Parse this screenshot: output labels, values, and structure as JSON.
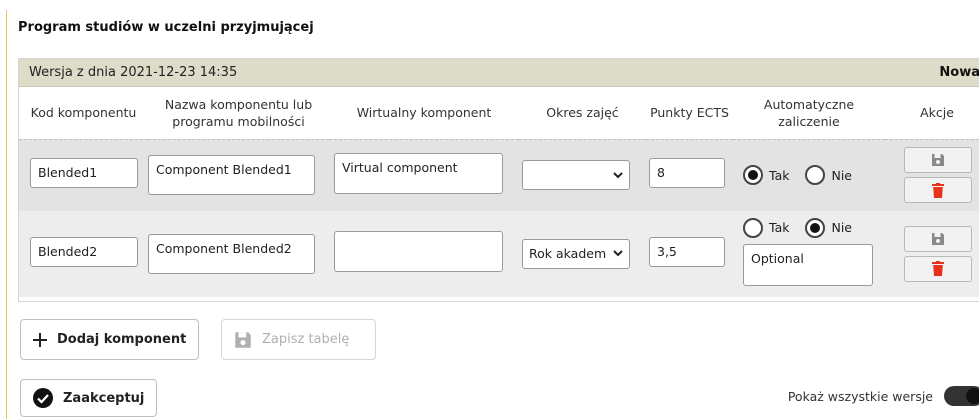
{
  "section": {
    "title": "Program studiów w uczelni przyjmującej"
  },
  "version": {
    "label": "Wersja z dnia 2021-12-23 14:35",
    "new_label": "Nowa"
  },
  "table": {
    "headers": {
      "code": "Kod komponentu",
      "name": "Nazwa komponentu lub programu mobilności",
      "virtual": "Wirtualny komponent",
      "period": "Okres zajęć",
      "ects": "Punkty ECTS",
      "auto": "Automatyczne zaliczenie",
      "actions": "Akcje"
    },
    "rows": [
      {
        "code": "Blended1",
        "name": "Component Blended1",
        "virtual": "Virtual component",
        "period": "",
        "ects": "8",
        "auto_yes": "Tak",
        "auto_no": "Nie",
        "auto_selected": "Tak",
        "note": ""
      },
      {
        "code": "Blended2",
        "name": "Component Blended2",
        "virtual": "",
        "period": "Rok akadem",
        "ects": "3,5",
        "auto_yes": "Tak",
        "auto_no": "Nie",
        "auto_selected": "Nie",
        "note": "Optional"
      }
    ]
  },
  "buttons": {
    "add": "Dodaj komponent",
    "save_table": "Zapisz tabelę",
    "accept": "Zaakceptuj"
  },
  "toggle": {
    "label": "Pokaż wszystkie wersje",
    "on": true
  },
  "colors": {
    "delete_red": "#e8321c",
    "save_gray": "#8a8a8a",
    "version_bar": "#dcdcc8"
  },
  "icons": {
    "add": "plus-icon",
    "save": "floppy-disk-icon",
    "delete": "trash-icon",
    "accept": "check-circle-icon",
    "select": "chevron-down-icon"
  }
}
